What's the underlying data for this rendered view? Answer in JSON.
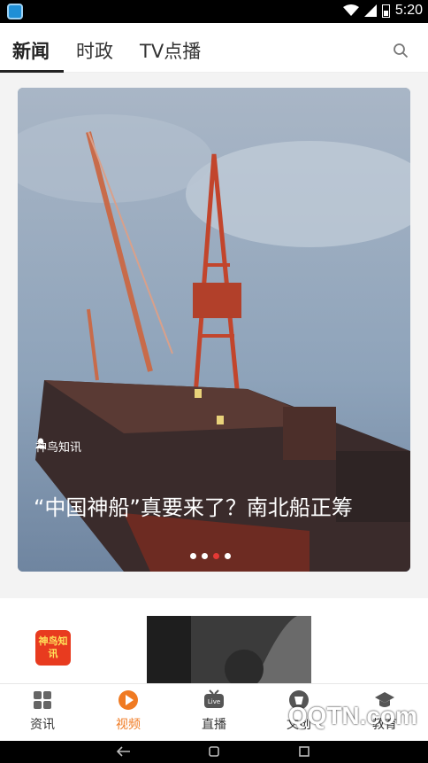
{
  "status_bar": {
    "time": "5:20"
  },
  "top_tabs": [
    {
      "label": "新闻",
      "active": true
    },
    {
      "label": "时政",
      "active": false
    },
    {
      "label": "TV点播",
      "active": false
    }
  ],
  "banner": {
    "source": "神鸟知讯",
    "headline": "“中国神船”真要来了？南北船正筹",
    "pages": 4,
    "active_page": 3
  },
  "feed_card": {
    "logo_text": "神鸟知讯"
  },
  "bottom_nav": [
    {
      "label": "资讯",
      "icon": "grid-icon",
      "active": false
    },
    {
      "label": "视频",
      "icon": "play-icon",
      "active": true
    },
    {
      "label": "直播",
      "icon": "live-tv-icon",
      "active": false
    },
    {
      "label": "文创",
      "icon": "creative-icon",
      "active": false
    },
    {
      "label": "教育",
      "icon": "graduation-cap-icon",
      "active": false
    }
  ],
  "watermark": {
    "text": "QQTN.com",
    "sub": "腾牛网"
  },
  "colors": {
    "accent": "#f07a22",
    "indicator": "#e53935"
  }
}
